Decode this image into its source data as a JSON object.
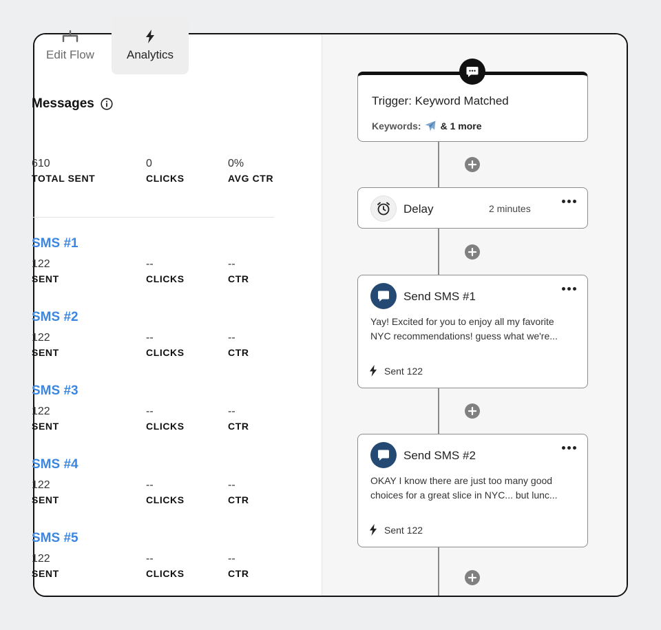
{
  "tabs": [
    {
      "label": "Edit Flow",
      "icon": "flow-icon"
    },
    {
      "label": "Analytics",
      "icon": "bolt-icon",
      "active": true
    }
  ],
  "messages": {
    "title": "Messages",
    "stats": [
      {
        "value": "610",
        "label": "TOTAL SENT"
      },
      {
        "value": "0",
        "label": "CLICKS"
      },
      {
        "value": "0%",
        "label": "AVG CTR"
      }
    ]
  },
  "sms_list": [
    {
      "title": "SMS #1",
      "sent": "122",
      "sent_label": "SENT",
      "clicks": "--",
      "clicks_label": "CLICKS",
      "ctr": "--",
      "ctr_label": "CTR"
    },
    {
      "title": "SMS #2",
      "sent": "122",
      "sent_label": "SENT",
      "clicks": "--",
      "clicks_label": "CLICKS",
      "ctr": "--",
      "ctr_label": "CTR"
    },
    {
      "title": "SMS #3",
      "sent": "122",
      "sent_label": "SENT",
      "clicks": "--",
      "clicks_label": "CLICKS",
      "ctr": "--",
      "ctr_label": "CTR"
    },
    {
      "title": "SMS #4",
      "sent": "122",
      "sent_label": "SENT",
      "clicks": "--",
      "clicks_label": "CLICKS",
      "ctr": "--",
      "ctr_label": "CTR"
    },
    {
      "title": "SMS #5",
      "sent": "122",
      "sent_label": "SENT",
      "clicks": "--",
      "clicks_label": "CLICKS",
      "ctr": "--",
      "ctr_label": "CTR"
    }
  ],
  "flow": {
    "trigger": {
      "title": "Trigger: Keyword Matched",
      "keywords_label": "Keywords:",
      "keywords_more": "& 1 more"
    },
    "delay": {
      "label": "Delay",
      "value": "2 minutes"
    },
    "sms_cards": [
      {
        "title": "Send SMS #1",
        "body": "Yay! Excited for you to enjoy all my favorite NYC recommendations! guess what we're...",
        "sent": "Sent 122"
      },
      {
        "title": "Send SMS #2",
        "body": "OKAY I know there are just too many good choices for a great slice in NYC... but lunc...",
        "sent": "Sent 122"
      }
    ]
  },
  "colors": {
    "accent": "#3b86e0",
    "sms_icon_bg": "#244a73"
  }
}
